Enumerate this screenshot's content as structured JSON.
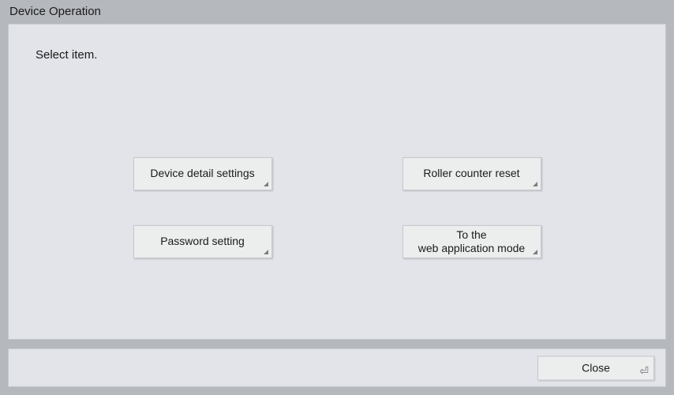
{
  "window": {
    "title": "Device Operation"
  },
  "main": {
    "prompt": "Select item.",
    "buttons": {
      "device_detail": "Device detail settings",
      "roller_counter": "Roller counter reset",
      "password": "Password setting",
      "web_app_line1": "To the",
      "web_app_line2": "web application mode"
    }
  },
  "footer": {
    "close": "Close"
  }
}
